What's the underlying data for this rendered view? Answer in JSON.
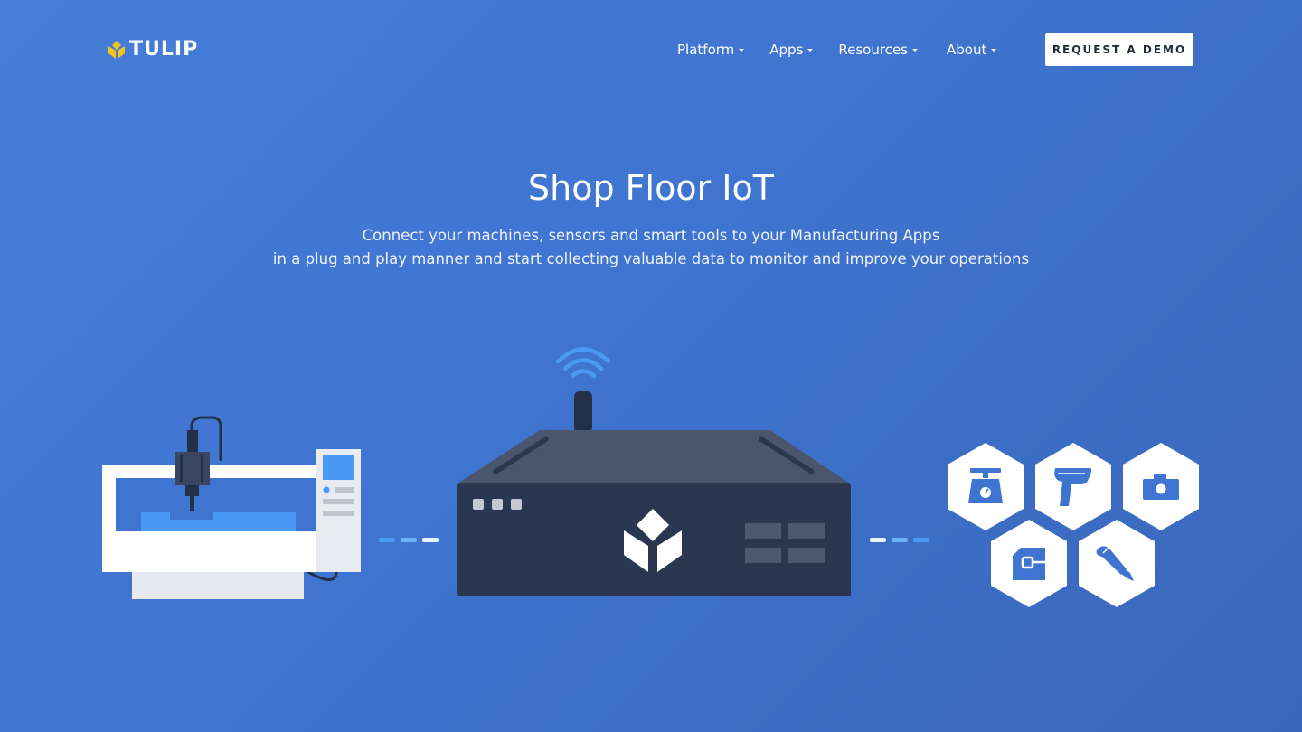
{
  "brand": {
    "name": "TULIP",
    "logo_color": "#f5c518"
  },
  "nav": {
    "items": [
      {
        "label": "Platform"
      },
      {
        "label": "Apps"
      },
      {
        "label": "Resources"
      },
      {
        "label": "About"
      }
    ],
    "cta_label": "REQUEST A DEMO"
  },
  "hero": {
    "title": "Shop Floor IoT",
    "subtitle_line1": "Connect your machines, sensors and smart tools to your Manufacturing Apps",
    "subtitle_line2": "in a plug and play manner and start collecting valuable data to monitor and improve your operations"
  },
  "illustration": {
    "machine": "cnc-machine",
    "gateway": "tulip-gateway",
    "devices": [
      "scale-icon",
      "barcode-scanner-icon",
      "camera-icon",
      "sensor-icon",
      "screwdriver-icon"
    ]
  },
  "colors": {
    "background_start": "#467ed9",
    "background_end": "#3a67b9",
    "gateway_dark": "#2b3650",
    "accent_blue": "#4a9af5"
  }
}
